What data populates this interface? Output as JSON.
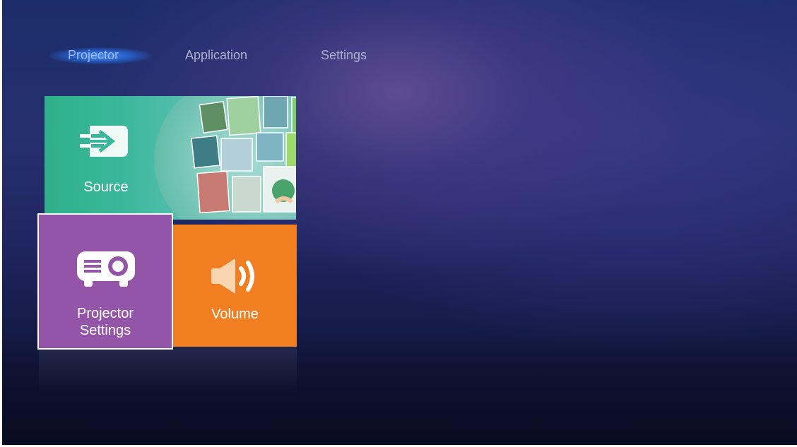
{
  "nav": {
    "tabs": [
      {
        "label": "Projector",
        "active": true
      },
      {
        "label": "Application",
        "active": false
      },
      {
        "label": "Settings",
        "active": false
      }
    ]
  },
  "tiles": {
    "source": {
      "label": "Source",
      "icon": "source-input-icon",
      "color": "#35b391"
    },
    "projector_settings": {
      "label_line1": "Projector",
      "label_line2": "Settings",
      "icon": "projector-icon",
      "color": "#9455a8",
      "focused": true
    },
    "volume": {
      "label": "Volume",
      "icon": "speaker-volume-icon",
      "color": "#f17f22"
    }
  },
  "colors": {
    "background": "#1f2560",
    "nav_active_glow": "#3a8cf0",
    "nav_text": "#aab2cc"
  }
}
